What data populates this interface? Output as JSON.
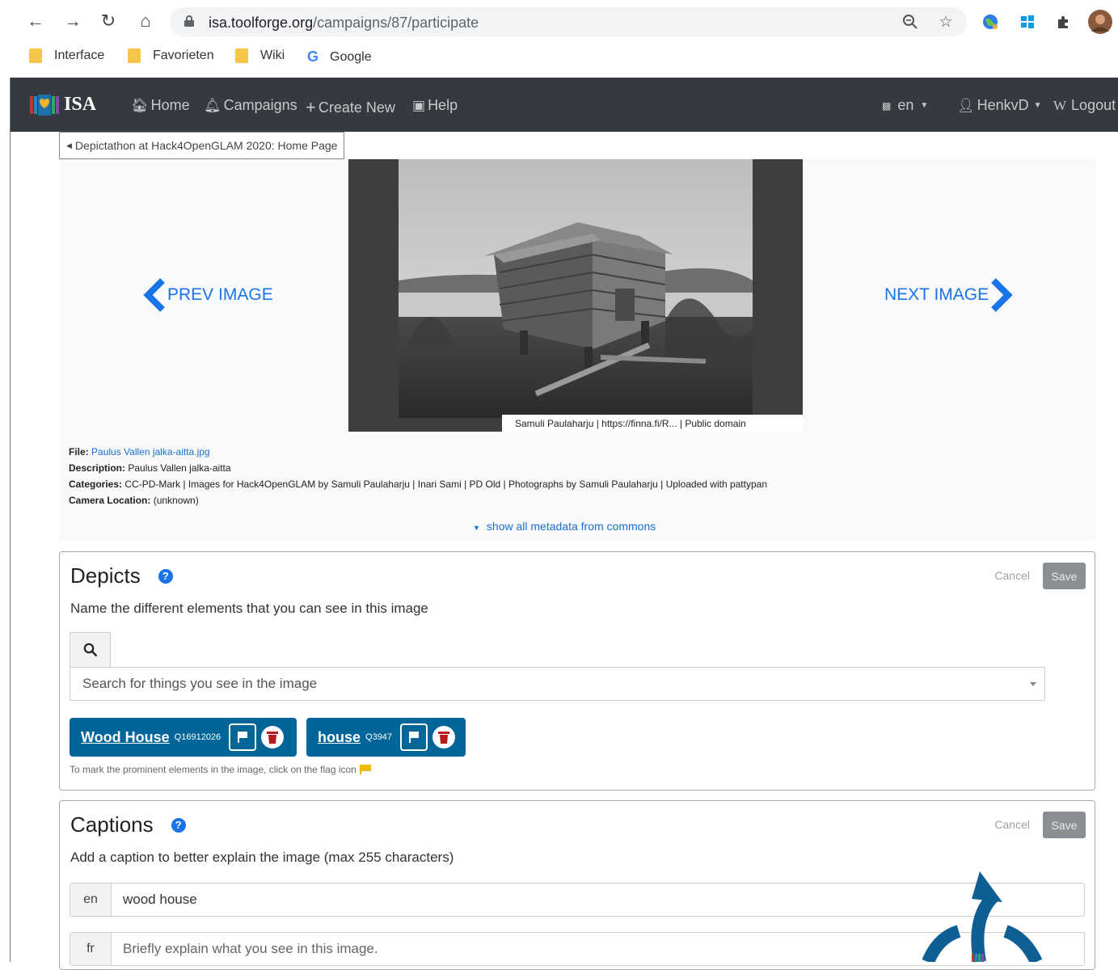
{
  "browser": {
    "url_host": "isa.toolforge.org",
    "url_path": "/campaigns/87/participate",
    "bookmarks": [
      "Interface",
      "Favorieten",
      "Wiki",
      "Google"
    ]
  },
  "navbar": {
    "brand": "ISA",
    "links": [
      "Home",
      "Campaigns",
      "Create New",
      "Help"
    ],
    "language": "en",
    "user": "HenkvD",
    "logout": "Logout"
  },
  "breadcrumb": "Depictathon at Hack4OpenGLAM 2020: Home Page",
  "viewer": {
    "prev_label": "PREV IMAGE",
    "next_label": "NEXT IMAGE",
    "attribution": "Samuli Paulaharju | https://finna.fi/R... | Public domain"
  },
  "metadata": {
    "file_label": "File:",
    "file_value": "Paulus Vallen jalka-aitta.jpg",
    "description_label": "Description:",
    "description_value": "Paulus Vallen jalka-aitta",
    "categories_label": "Categories:",
    "categories_value": "CC-PD-Mark | Images for Hack4OpenGLAM by Samuli Paulaharju | Inari Sami | PD Old | Photographs by Samuli Paulaharju | Uploaded with pattypan",
    "camera_label": "Camera Location:",
    "camera_value": "(unknown)",
    "show_all": "show all metadata from commons"
  },
  "depicts": {
    "title": "Depicts",
    "subtitle": "Name the different elements that you can see in this image",
    "cancel": "Cancel",
    "save": "Save",
    "search_placeholder": "Search for things you see in the image",
    "tags": [
      {
        "label": "Wood House",
        "qid": "Q16912026"
      },
      {
        "label": "house",
        "qid": "Q3947"
      }
    ],
    "hint": "To mark the prominent elements in the image, click on the flag icon"
  },
  "captions": {
    "title": "Captions",
    "subtitle": "Add a caption to better explain the image (max 255 characters)",
    "cancel": "Cancel",
    "save": "Save",
    "rows": [
      {
        "lang": "en",
        "value": "wood house"
      },
      {
        "lang": "fr",
        "placeholder": "Briefly explain what you see in this image."
      }
    ]
  }
}
